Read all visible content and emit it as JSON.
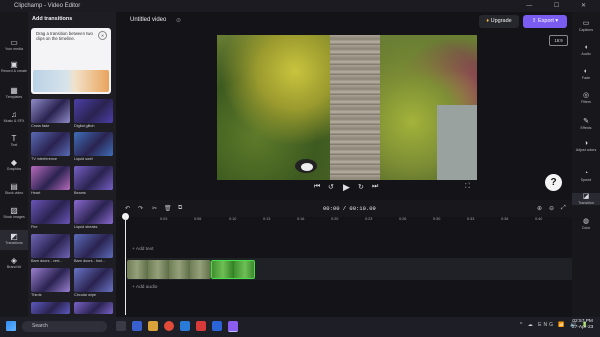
{
  "titlebar": {
    "app_title": "Clipchamp - Video Editor",
    "controls": "—  ☐  ✕"
  },
  "left_nav": [
    {
      "label": "Your media",
      "icon": "folder-icon"
    },
    {
      "label": "Record & create",
      "icon": "camera-icon"
    },
    {
      "label": "Templates",
      "icon": "templates-icon"
    },
    {
      "label": "Music & SFX",
      "icon": "music-icon"
    },
    {
      "label": "Text",
      "icon": "text-icon"
    },
    {
      "label": "Graphics",
      "icon": "graphics-icon"
    },
    {
      "label": "Stock video",
      "icon": "film-icon"
    },
    {
      "label": "Stock images",
      "icon": "image-icon"
    },
    {
      "label": "Transitions",
      "icon": "transitions-icon"
    },
    {
      "label": "Brand kit",
      "icon": "brand-icon"
    }
  ],
  "panel": {
    "title": "Add transitions",
    "tip": "Drag a transition between two clips on the timeline.",
    "tip_close": "✕",
    "transitions": [
      {
        "label": "Cross fade",
        "color": "#8f8cc9"
      },
      {
        "label": "Digital glitch",
        "color": "#4b3fa8"
      },
      {
        "label": "TV interference",
        "color": "#5a6bb5"
      },
      {
        "label": "Liquid swirl",
        "color": "#3f6fb8"
      },
      {
        "label": "Heart",
        "color": "#b86bbd"
      },
      {
        "label": "Beams",
        "color": "#7660c4"
      },
      {
        "label": "Fire",
        "color": "#6a55b8"
      },
      {
        "label": "Liquid streaks",
        "color": "#8b6ad0"
      },
      {
        "label": "Barn doors - vert...",
        "color": "#6f66b7"
      },
      {
        "label": "Barn doors - hori...",
        "color": "#5c6cb9"
      },
      {
        "label": "Thirds",
        "color": "#9a7fd0"
      },
      {
        "label": "Circular wipe",
        "color": "#6a74c5"
      },
      {
        "label": "",
        "color": "#5e5ac0"
      },
      {
        "label": "",
        "color": "#7a64c8"
      }
    ]
  },
  "header": {
    "project_name": "Untitled video",
    "upgrade_label": "Upgrade",
    "export_label": "Export",
    "aspect_ratio": "16:9"
  },
  "player": {
    "prev": "⏮",
    "back5": "↺",
    "play": "▶",
    "fwd5": "↻",
    "next": "⏭",
    "fullscreen": "⛶",
    "help": "?"
  },
  "right_nav": [
    {
      "label": "Captions",
      "icon": "captions-icon"
    },
    {
      "label": "Audio",
      "icon": "audio-icon"
    },
    {
      "label": "Fade",
      "icon": "fade-icon"
    },
    {
      "label": "Filters",
      "icon": "filters-icon"
    },
    {
      "label": "Effects",
      "icon": "effects-icon"
    },
    {
      "label": "Adjust colors",
      "icon": "adjust-colors-icon"
    },
    {
      "label": "Speed",
      "icon": "speed-icon"
    },
    {
      "label": "Transition",
      "icon": "transition-icon"
    },
    {
      "label": "Color",
      "icon": "color-icon"
    }
  ],
  "timeline": {
    "timecode": "00:00 / 00:10.09",
    "ruler": [
      "0",
      "0:03",
      "0:06",
      "0:10",
      "0:13",
      "0:16",
      "0:20",
      "0:23",
      "0:26",
      "0:30",
      "0:33",
      "0:36",
      "0:40",
      "0:43",
      "0:46",
      "0:50",
      "0:53"
    ],
    "add_text": "+ Add text",
    "add_audio": "+ Add audio",
    "tools": [
      "↶",
      "↷",
      "✂",
      "🗑",
      "⧉",
      "⊕",
      "⊖",
      "⤢"
    ]
  },
  "taskbar": {
    "search_placeholder": "Search",
    "time": "02:57 PM",
    "date": "27-Apr-23",
    "tray": "^ ☁ ENG 📶 🔊 🔋"
  }
}
